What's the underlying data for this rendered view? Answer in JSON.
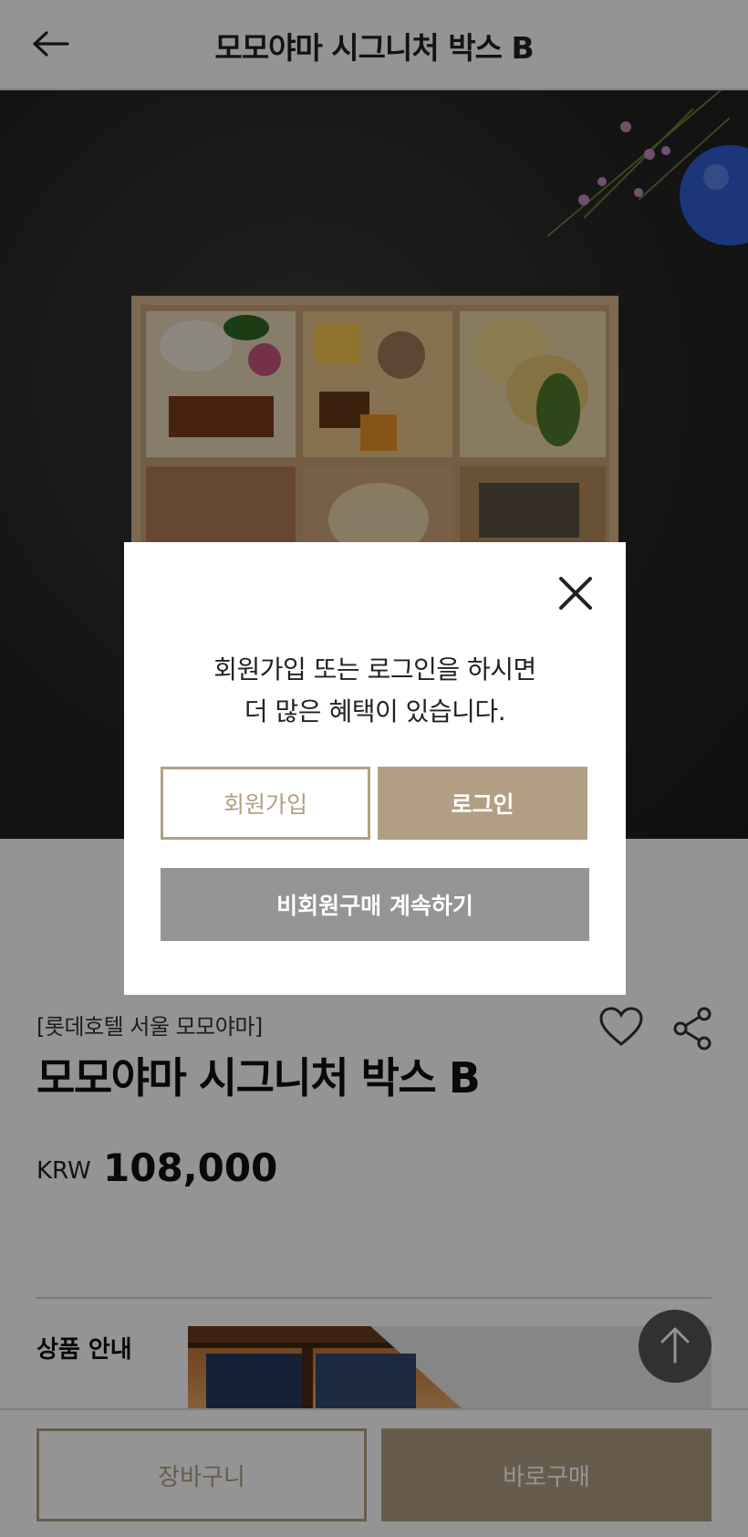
{
  "header": {
    "title": "모모야마 시그니처 박스 B"
  },
  "icons": {
    "back": "arrow-left-icon",
    "close": "close-icon",
    "favorite": "heart-icon",
    "share": "share-icon",
    "scroll_top": "arrow-up-icon"
  },
  "product": {
    "brand": "[롯데호텔 서울 모모야마]",
    "name": "모모야마 시그니처 박스 B",
    "currency": "KRW",
    "price": "108,000",
    "section_label": "상품 안내"
  },
  "bottom_bar": {
    "cart_label": "장바구니",
    "buy_label": "바로구매"
  },
  "modal": {
    "message_line1": "회원가입 또는 로그인을 하시면",
    "message_line2": "더 많은 혜택이 있습니다.",
    "signup_label": "회원가입",
    "login_label": "로그인",
    "guest_label": "비회원구매 계속하기"
  },
  "colors": {
    "accent": "#b29f83",
    "guest_button": "#959595",
    "overlay": "rgba(0,0,0,0.42)",
    "scroll_top_button": "#555555"
  }
}
